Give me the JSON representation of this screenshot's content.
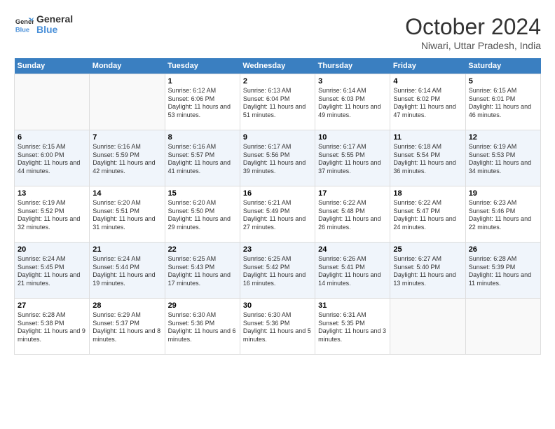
{
  "logo": {
    "text_general": "General",
    "text_blue": "Blue"
  },
  "header": {
    "month": "October 2024",
    "location": "Niwari, Uttar Pradesh, India"
  },
  "days_of_week": [
    "Sunday",
    "Monday",
    "Tuesday",
    "Wednesday",
    "Thursday",
    "Friday",
    "Saturday"
  ],
  "weeks": [
    [
      {
        "day": "",
        "sunrise": "",
        "sunset": "",
        "daylight": ""
      },
      {
        "day": "",
        "sunrise": "",
        "sunset": "",
        "daylight": ""
      },
      {
        "day": "1",
        "sunrise": "Sunrise: 6:12 AM",
        "sunset": "Sunset: 6:06 PM",
        "daylight": "Daylight: 11 hours and 53 minutes."
      },
      {
        "day": "2",
        "sunrise": "Sunrise: 6:13 AM",
        "sunset": "Sunset: 6:04 PM",
        "daylight": "Daylight: 11 hours and 51 minutes."
      },
      {
        "day": "3",
        "sunrise": "Sunrise: 6:14 AM",
        "sunset": "Sunset: 6:03 PM",
        "daylight": "Daylight: 11 hours and 49 minutes."
      },
      {
        "day": "4",
        "sunrise": "Sunrise: 6:14 AM",
        "sunset": "Sunset: 6:02 PM",
        "daylight": "Daylight: 11 hours and 47 minutes."
      },
      {
        "day": "5",
        "sunrise": "Sunrise: 6:15 AM",
        "sunset": "Sunset: 6:01 PM",
        "daylight": "Daylight: 11 hours and 46 minutes."
      }
    ],
    [
      {
        "day": "6",
        "sunrise": "Sunrise: 6:15 AM",
        "sunset": "Sunset: 6:00 PM",
        "daylight": "Daylight: 11 hours and 44 minutes."
      },
      {
        "day": "7",
        "sunrise": "Sunrise: 6:16 AM",
        "sunset": "Sunset: 5:59 PM",
        "daylight": "Daylight: 11 hours and 42 minutes."
      },
      {
        "day": "8",
        "sunrise": "Sunrise: 6:16 AM",
        "sunset": "Sunset: 5:57 PM",
        "daylight": "Daylight: 11 hours and 41 minutes."
      },
      {
        "day": "9",
        "sunrise": "Sunrise: 6:17 AM",
        "sunset": "Sunset: 5:56 PM",
        "daylight": "Daylight: 11 hours and 39 minutes."
      },
      {
        "day": "10",
        "sunrise": "Sunrise: 6:17 AM",
        "sunset": "Sunset: 5:55 PM",
        "daylight": "Daylight: 11 hours and 37 minutes."
      },
      {
        "day": "11",
        "sunrise": "Sunrise: 6:18 AM",
        "sunset": "Sunset: 5:54 PM",
        "daylight": "Daylight: 11 hours and 36 minutes."
      },
      {
        "day": "12",
        "sunrise": "Sunrise: 6:19 AM",
        "sunset": "Sunset: 5:53 PM",
        "daylight": "Daylight: 11 hours and 34 minutes."
      }
    ],
    [
      {
        "day": "13",
        "sunrise": "Sunrise: 6:19 AM",
        "sunset": "Sunset: 5:52 PM",
        "daylight": "Daylight: 11 hours and 32 minutes."
      },
      {
        "day": "14",
        "sunrise": "Sunrise: 6:20 AM",
        "sunset": "Sunset: 5:51 PM",
        "daylight": "Daylight: 11 hours and 31 minutes."
      },
      {
        "day": "15",
        "sunrise": "Sunrise: 6:20 AM",
        "sunset": "Sunset: 5:50 PM",
        "daylight": "Daylight: 11 hours and 29 minutes."
      },
      {
        "day": "16",
        "sunrise": "Sunrise: 6:21 AM",
        "sunset": "Sunset: 5:49 PM",
        "daylight": "Daylight: 11 hours and 27 minutes."
      },
      {
        "day": "17",
        "sunrise": "Sunrise: 6:22 AM",
        "sunset": "Sunset: 5:48 PM",
        "daylight": "Daylight: 11 hours and 26 minutes."
      },
      {
        "day": "18",
        "sunrise": "Sunrise: 6:22 AM",
        "sunset": "Sunset: 5:47 PM",
        "daylight": "Daylight: 11 hours and 24 minutes."
      },
      {
        "day": "19",
        "sunrise": "Sunrise: 6:23 AM",
        "sunset": "Sunset: 5:46 PM",
        "daylight": "Daylight: 11 hours and 22 minutes."
      }
    ],
    [
      {
        "day": "20",
        "sunrise": "Sunrise: 6:24 AM",
        "sunset": "Sunset: 5:45 PM",
        "daylight": "Daylight: 11 hours and 21 minutes."
      },
      {
        "day": "21",
        "sunrise": "Sunrise: 6:24 AM",
        "sunset": "Sunset: 5:44 PM",
        "daylight": "Daylight: 11 hours and 19 minutes."
      },
      {
        "day": "22",
        "sunrise": "Sunrise: 6:25 AM",
        "sunset": "Sunset: 5:43 PM",
        "daylight": "Daylight: 11 hours and 17 minutes."
      },
      {
        "day": "23",
        "sunrise": "Sunrise: 6:25 AM",
        "sunset": "Sunset: 5:42 PM",
        "daylight": "Daylight: 11 hours and 16 minutes."
      },
      {
        "day": "24",
        "sunrise": "Sunrise: 6:26 AM",
        "sunset": "Sunset: 5:41 PM",
        "daylight": "Daylight: 11 hours and 14 minutes."
      },
      {
        "day": "25",
        "sunrise": "Sunrise: 6:27 AM",
        "sunset": "Sunset: 5:40 PM",
        "daylight": "Daylight: 11 hours and 13 minutes."
      },
      {
        "day": "26",
        "sunrise": "Sunrise: 6:28 AM",
        "sunset": "Sunset: 5:39 PM",
        "daylight": "Daylight: 11 hours and 11 minutes."
      }
    ],
    [
      {
        "day": "27",
        "sunrise": "Sunrise: 6:28 AM",
        "sunset": "Sunset: 5:38 PM",
        "daylight": "Daylight: 11 hours and 9 minutes."
      },
      {
        "day": "28",
        "sunrise": "Sunrise: 6:29 AM",
        "sunset": "Sunset: 5:37 PM",
        "daylight": "Daylight: 11 hours and 8 minutes."
      },
      {
        "day": "29",
        "sunrise": "Sunrise: 6:30 AM",
        "sunset": "Sunset: 5:36 PM",
        "daylight": "Daylight: 11 hours and 6 minutes."
      },
      {
        "day": "30",
        "sunrise": "Sunrise: 6:30 AM",
        "sunset": "Sunset: 5:36 PM",
        "daylight": "Daylight: 11 hours and 5 minutes."
      },
      {
        "day": "31",
        "sunrise": "Sunrise: 6:31 AM",
        "sunset": "Sunset: 5:35 PM",
        "daylight": "Daylight: 11 hours and 3 minutes."
      },
      {
        "day": "",
        "sunrise": "",
        "sunset": "",
        "daylight": ""
      },
      {
        "day": "",
        "sunrise": "",
        "sunset": "",
        "daylight": ""
      }
    ]
  ]
}
